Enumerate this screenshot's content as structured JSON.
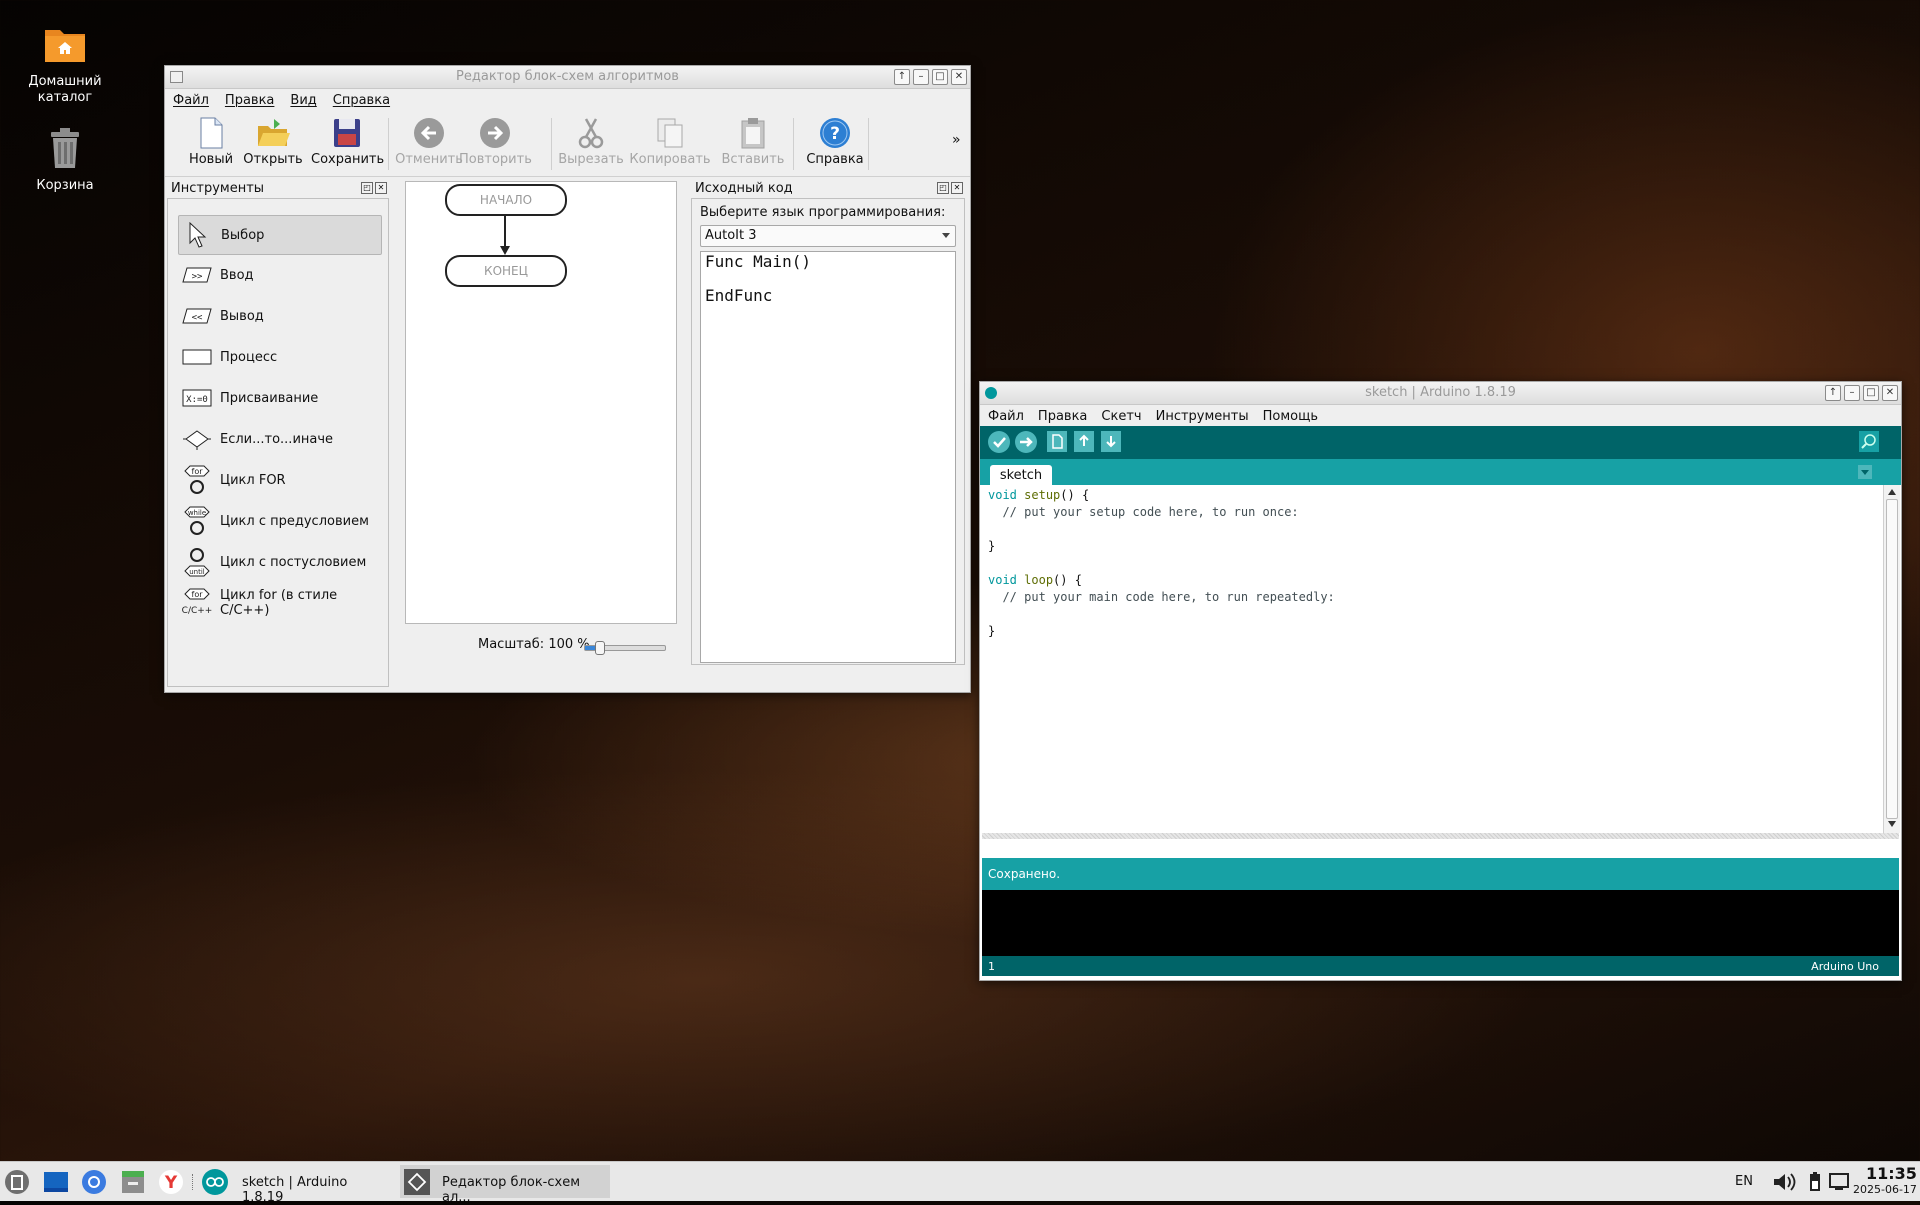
{
  "desktop": {
    "icons": [
      {
        "label": "Домашний каталог"
      },
      {
        "label": "Корзина"
      }
    ]
  },
  "flowchart": {
    "title": "Редактор блок-схем алгоритмов",
    "menu": [
      "Файл",
      "Правка",
      "Вид",
      "Справка"
    ],
    "toolbar": [
      {
        "label": "Новый",
        "enabled": true
      },
      {
        "label": "Открыть",
        "enabled": true
      },
      {
        "label": "Сохранить",
        "enabled": true
      },
      {
        "label": "Отменить",
        "enabled": false
      },
      {
        "label": "Повторить",
        "enabled": false
      },
      {
        "label": "Вырезать",
        "enabled": false
      },
      {
        "label": "Копировать",
        "enabled": false
      },
      {
        "label": "Вставить",
        "enabled": false
      },
      {
        "label": "Справка",
        "enabled": true
      }
    ],
    "more": "»",
    "tools_panel": {
      "title": "Инструменты",
      "items": [
        {
          "label": "Выбор",
          "icon": "pointer-icon",
          "selected": true
        },
        {
          "label": "Ввод",
          "icon_text": ">>"
        },
        {
          "label": "Вывод",
          "icon_text": "<<"
        },
        {
          "label": "Процесс"
        },
        {
          "label": "Присваивание",
          "icon_text": "X:=0"
        },
        {
          "label": "Если...то...иначе"
        },
        {
          "label": "Цикл FOR",
          "icon_text": "for"
        },
        {
          "label": "Цикл с предусловием",
          "icon_text": "while"
        },
        {
          "label": "Цикл с постусловием",
          "icon_text": "until"
        },
        {
          "label": "Цикл for (в стиле C/C++)",
          "icon_text": "for",
          "icon_text2": "C/C++"
        }
      ]
    },
    "canvas": {
      "start": "НАЧАЛО",
      "end": "КОНЕЦ",
      "zoom_label": "Масштаб:",
      "zoom_value": "100 %",
      "zoom_fraction": 0.15
    },
    "source_panel": {
      "title": "Исходный код",
      "language_label": "Выберите язык программирования:",
      "language": "AutoIt 3",
      "code_line1": "Func Main()",
      "code_line2": "EndFunc"
    }
  },
  "arduino": {
    "title": "sketch | Arduino 1.8.19",
    "menu": [
      "Файл",
      "Правка",
      "Скетч",
      "Инструменты",
      "Помощь"
    ],
    "tab": "sketch",
    "code": {
      "l1_kw": "void",
      "l1_fn": "setup",
      "l1_rest": "() {",
      "l2": "  // put your setup code here, to run once:",
      "l4": "}",
      "l6_kw": "void",
      "l6_fn": "loop",
      "l6_rest": "() {",
      "l7": "  // put your main code here, to run repeatedly:",
      "l9": "}"
    },
    "status": "Сохранено.",
    "line_number": "1",
    "board": "Arduino Uno"
  },
  "taskbar": {
    "tasks": [
      "sketch | Arduino 1.8.19",
      "Редактор блок-схем ал..."
    ],
    "lang": "EN",
    "time": "11:35",
    "date": "2025-06-17"
  },
  "colors": {
    "arduino_dark": "#006468",
    "arduino_teal": "#17a1a5"
  }
}
